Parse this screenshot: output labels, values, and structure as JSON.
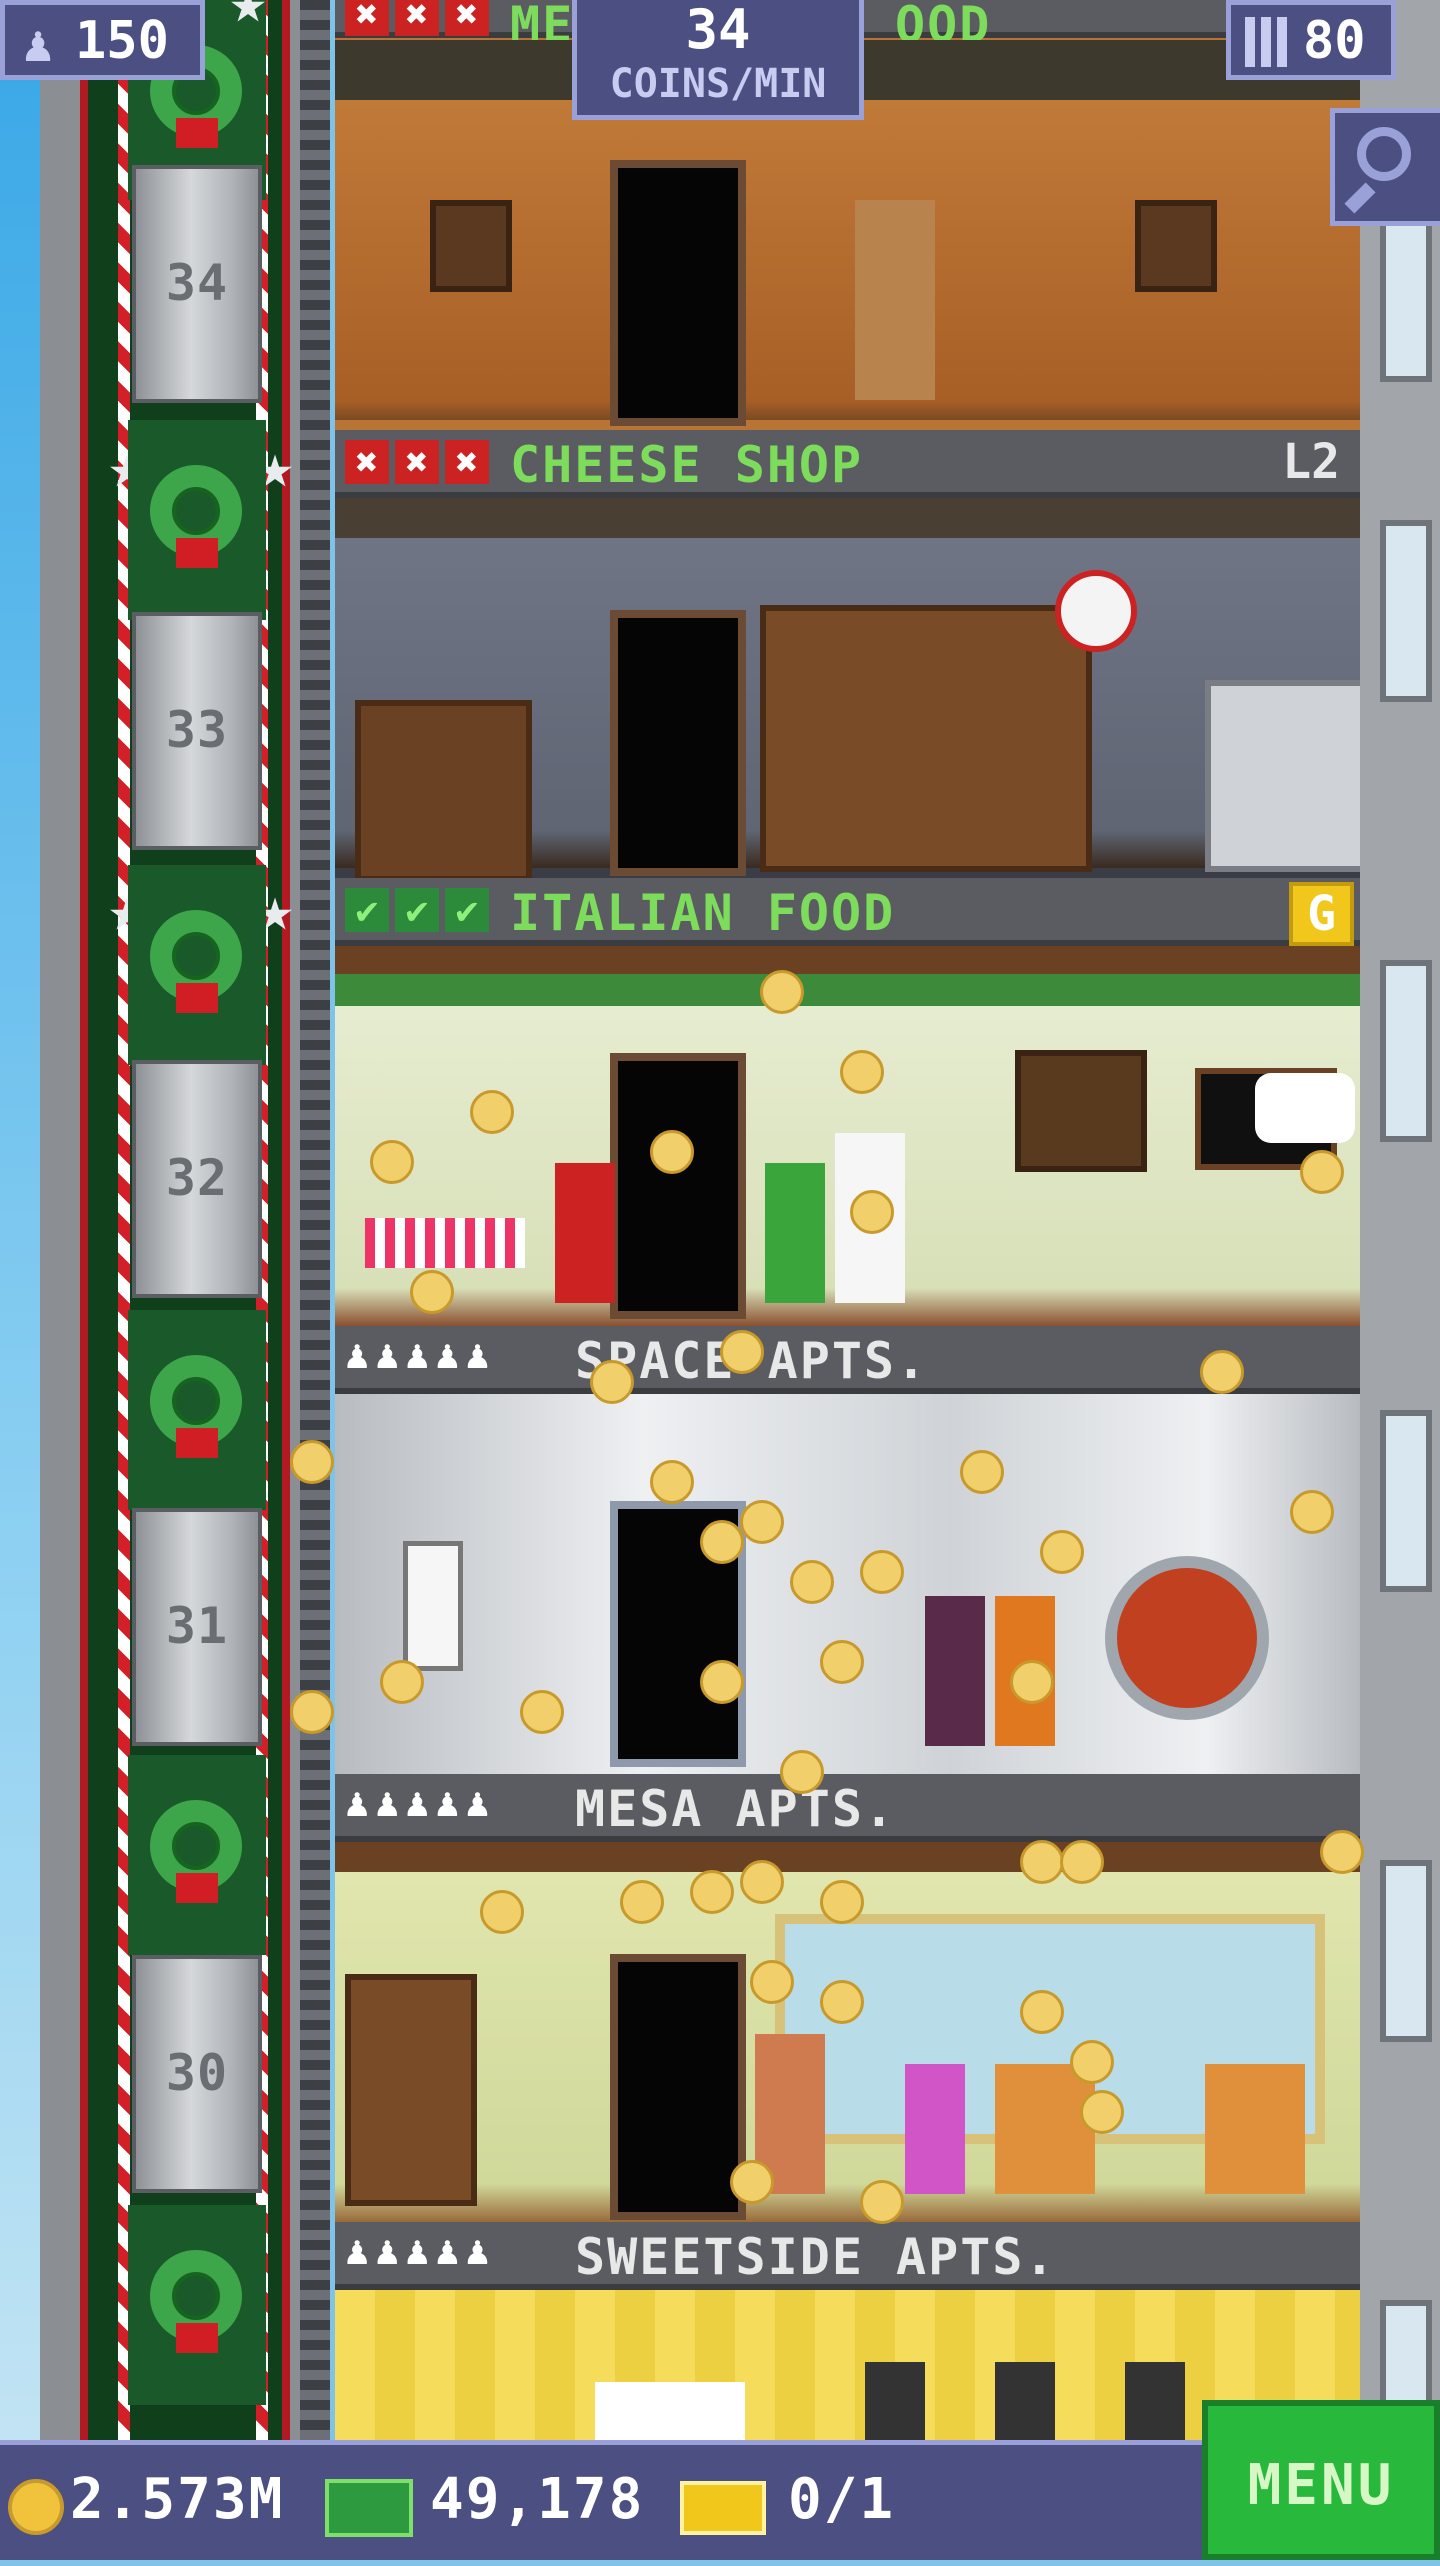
{
  "colors": {
    "ui_panel": "#4b4f82",
    "ui_border": "#9aa0d8",
    "menu_green": "#27b83c",
    "shop_title_green": "#7ddc5b",
    "gold_badge": "#f2c71c"
  },
  "header": {
    "population": "150",
    "coins_rate_value": "34",
    "coins_rate_unit": "COINS/MIN",
    "floors_count": "80",
    "population_icon": "person-icon",
    "floors_icon": "building-icon",
    "zoom_icon": "magnifier-minus-icon"
  },
  "elevator": {
    "floor_numbers": [
      "34",
      "33",
      "32",
      "31",
      "30"
    ]
  },
  "floors": {
    "top": {
      "name": "ME",
      "name_suffix": "OOD",
      "marks": [
        "x",
        "x",
        "x"
      ]
    },
    "cheese": {
      "name": "CHEESE SHOP",
      "level": "L2",
      "marks": [
        "x",
        "x",
        "x"
      ]
    },
    "italian": {
      "name": "ITALIAN FOOD",
      "badge": "G",
      "marks": [
        "check",
        "check",
        "check"
      ]
    },
    "space": {
      "name": "SPACE APTS.",
      "residents": "♟♟♟♟♟"
    },
    "mesa": {
      "name": "MESA APTS.",
      "residents": "♟♟♟♟♟"
    },
    "sweetside": {
      "name": "SWEETSIDE APTS.",
      "residents": "♟♟♟♟♟"
    }
  },
  "footer": {
    "coins": "2.573M",
    "bux": "49,178",
    "tickets": "0/1",
    "menu_label": "MENU"
  }
}
